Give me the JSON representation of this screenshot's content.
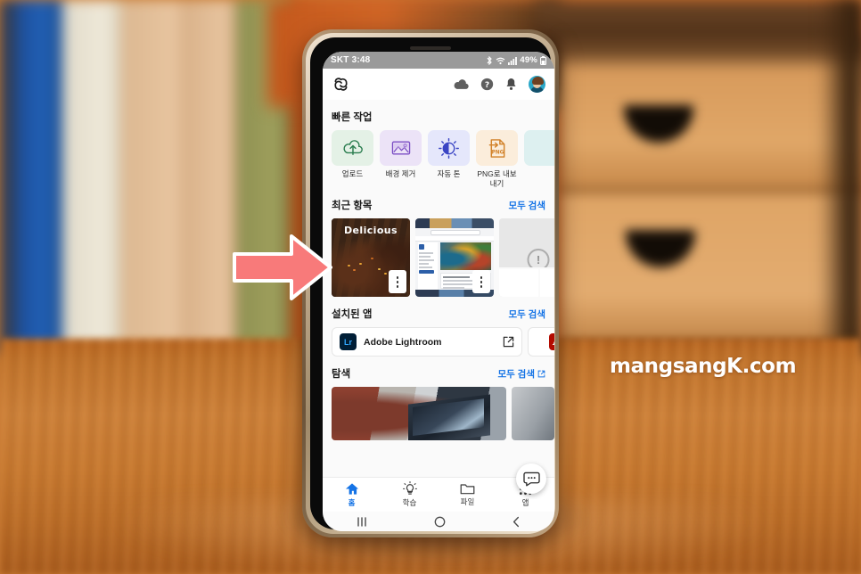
{
  "scene": {
    "watermark": "mangsangK.com",
    "annotation_arrow": "red-right-arrow",
    "arrow_color": "#f87a7a"
  },
  "status_bar": {
    "carrier_time": "SKT 3:48",
    "battery": "49%",
    "icons": [
      "bluetooth-icon",
      "wifi-icon",
      "signal-icon",
      "battery-icon"
    ]
  },
  "app_header": {
    "logo": "creative-cloud-logo",
    "icons": [
      "cloud-icon",
      "help-icon",
      "notification-bell-icon",
      "avatar"
    ]
  },
  "quick_actions": {
    "title": "빠른 작업",
    "items": [
      {
        "label": "업로드",
        "icon": "cloud-upload-icon",
        "tile_color": "#e4f1e6",
        "icon_color": "#2a7d4f"
      },
      {
        "label": "배경 제거",
        "icon": "image-icon",
        "tile_color": "#ece3f7",
        "icon_color": "#7b4ec4"
      },
      {
        "label": "자동 톤",
        "icon": "brightness-icon",
        "tile_color": "#e5e7fb",
        "icon_color": "#3a45c4"
      },
      {
        "label": "PNG로 내보내기",
        "icon": "export-png-icon",
        "tile_color": "#fbeddb",
        "icon_color": "#d2822a"
      },
      {
        "label": "",
        "icon": "partial-tile",
        "tile_color": "#ddf0f0",
        "icon_color": "#2b8f94"
      }
    ]
  },
  "recent_items": {
    "title": "최근 항목",
    "link": "모두 검색",
    "cards": [
      {
        "name": "delicious-cupcakes-thumbnail",
        "overlay_text": "Delicious",
        "has_menu": true
      },
      {
        "name": "webpage-screenshot-thumbnail",
        "overlay_text": "",
        "has_menu": true
      },
      {
        "name": "error-placeholder-thumbnail",
        "overlay_text": "!",
        "has_menu": false
      }
    ]
  },
  "installed_apps": {
    "title": "설치된 앱",
    "link": "모두 검색",
    "apps": [
      {
        "name": "Adobe Lightroom",
        "badge": "Lr",
        "action_icon": "external-link-icon"
      },
      {
        "name": "",
        "badge": "A",
        "action_icon": ""
      }
    ]
  },
  "explore": {
    "title": "탐색",
    "link": "모두 검색",
    "link_icon": "external-link-icon",
    "cards": [
      {
        "name": "explore-photo-person-at-laptop"
      },
      {
        "name": "explore-photo-secondary"
      }
    ]
  },
  "chat": {
    "fab_icon": "chat-bubble-icon"
  },
  "bottom_nav": {
    "items": [
      {
        "label": "홈",
        "icon": "home-icon",
        "active": true
      },
      {
        "label": "학습",
        "icon": "lightbulb-icon",
        "active": false
      },
      {
        "label": "파일",
        "icon": "folder-icon",
        "active": false
      },
      {
        "label": "앱",
        "icon": "grid-apps-icon",
        "active": false
      }
    ],
    "active_color": "#1473e6"
  },
  "system_nav": {
    "items": [
      "recents-icon",
      "home-circle-icon",
      "back-icon"
    ]
  }
}
